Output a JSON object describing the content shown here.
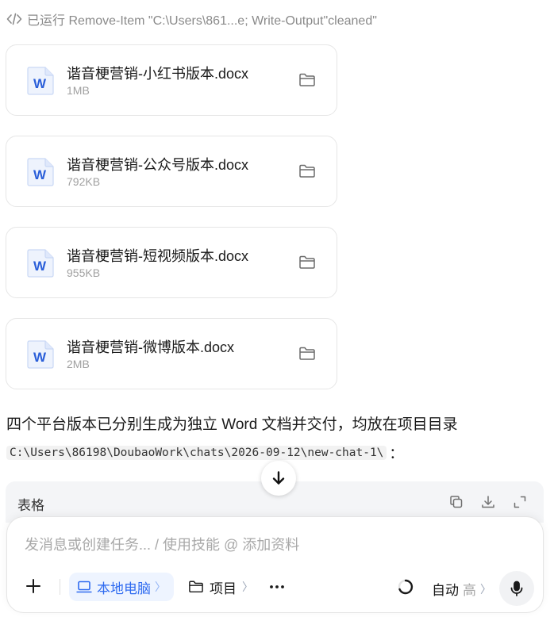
{
  "command": {
    "text": "已运行 Remove-Item \"C:\\Users\\861...e; Write-Output\"cleaned\""
  },
  "files": [
    {
      "name": "谐音梗营销-小红书版本.docx",
      "size": "1MB",
      "folder_icon": "folder-icon"
    },
    {
      "name": "谐音梗营销-公众号版本.docx",
      "size": "792KB",
      "folder_icon": "folder-icon"
    },
    {
      "name": "谐音梗营销-短视频版本.docx",
      "size": "955KB",
      "folder_icon": "folder-icon"
    },
    {
      "name": "谐音梗营销-微博版本.docx",
      "size": "2MB",
      "folder_icon": "folder-icon"
    }
  ],
  "summary": {
    "text": "四个平台版本已分别生成为独立 Word 文档并交付，均放在项目目录",
    "path": "C:\\Users\\86198\\DoubaoWork\\chats\\2026-09-12\\new-chat-1\\",
    "path_suffix": "："
  },
  "table": {
    "label": "表格"
  },
  "composer": {
    "placeholder": "发消息或创建任务... / 使用技能 @ 添加资料",
    "local_label": "本地电脑",
    "project_label": "项目",
    "chevron": "〉",
    "auto_label": "自动",
    "auto_level": "高"
  },
  "colors": {
    "accent": "#2f6bf0",
    "word_blue": "#2b5fd9",
    "muted": "#a0a0a0"
  }
}
